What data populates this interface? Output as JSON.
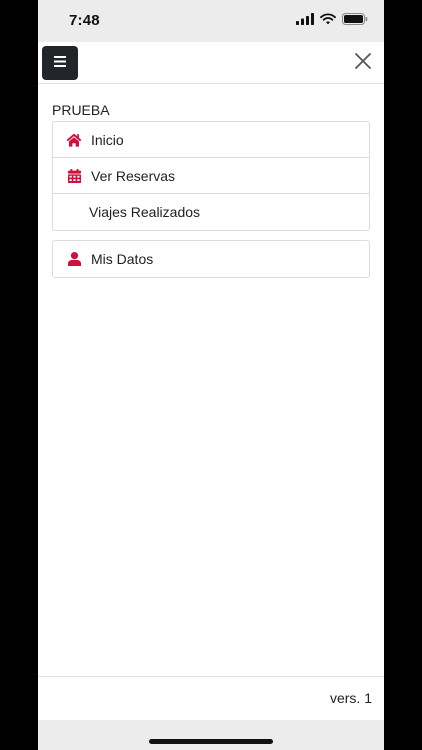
{
  "status_bar": {
    "time": "7:48",
    "icons": [
      "signal-icon",
      "wifi-icon",
      "battery-icon"
    ]
  },
  "toolbar": {
    "menu_icon": "hamburger-menu-icon",
    "close_icon": "close-icon"
  },
  "section": {
    "title": "PRUEBA"
  },
  "menu": {
    "items": [
      {
        "label": "Inicio",
        "icon": "home-icon"
      },
      {
        "label": "Ver Reservas",
        "icon": "calendar-icon"
      },
      {
        "label": "Viajes Realizados",
        "icon": ""
      }
    ]
  },
  "account": {
    "items": [
      {
        "label": "Mis Datos",
        "icon": "user-icon"
      }
    ]
  },
  "footer": {
    "version": "vers. 1"
  },
  "colors": {
    "accent": "#d0103a",
    "menu_button": "#22252a",
    "chrome": "#ececec"
  }
}
